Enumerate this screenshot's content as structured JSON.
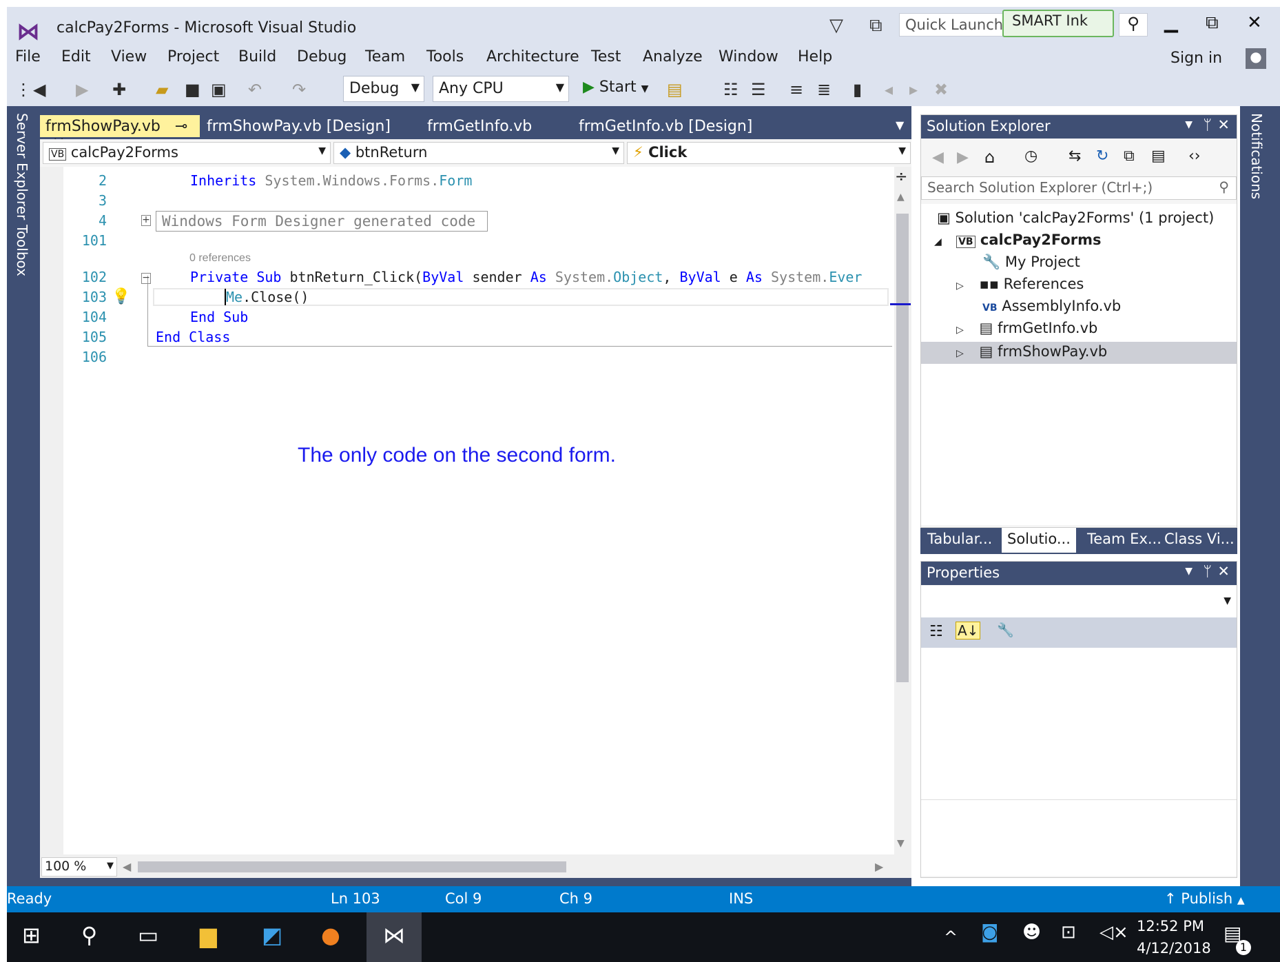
{
  "window": {
    "title": "calcPay2Forms - Microsoft Visual Studio",
    "quick_launch_placeholder": "Quick Launch",
    "smart_ink_label": "SMART Ink",
    "sign_in": "Sign in"
  },
  "menu": [
    "File",
    "Edit",
    "View",
    "Project",
    "Build",
    "Debug",
    "Team",
    "Tools",
    "Architecture",
    "Test",
    "Analyze",
    "Window",
    "Help"
  ],
  "toolbar": {
    "configuration": "Debug",
    "platform": "Any CPU",
    "start_label": "Start"
  },
  "side_tabs": {
    "left": [
      "Server Explorer",
      "Toolbox"
    ],
    "right": "Notifications"
  },
  "doc_tabs": [
    {
      "label": "frmShowPay.vb",
      "active": true
    },
    {
      "label": "frmShowPay.vb [Design]",
      "active": false
    },
    {
      "label": "frmGetInfo.vb",
      "active": false
    },
    {
      "label": "frmGetInfo.vb [Design]",
      "active": false
    }
  ],
  "navbar": {
    "project": "calcPay2Forms",
    "object": "btnReturn",
    "event": "Click"
  },
  "code": {
    "line_numbers": [
      "2",
      "3",
      "4",
      "101",
      "102",
      "103",
      "104",
      "105",
      "106"
    ],
    "region_label": "Windows Form Designer generated code",
    "codelens": "0 references",
    "inherits": {
      "kw": "Inherits",
      "ns": "System.Windows.Forms.",
      "ty": "Form"
    },
    "sub_line": {
      "kw1": "Private",
      "kw2": "Sub",
      "name": "btnReturn_Click(",
      "kw3": "ByVal",
      "p1": "sender",
      "kw4": "As",
      "ns1": "System.",
      "ty1": "Object",
      "sep": ", ",
      "kw5": "ByVal",
      "p2": "e",
      "kw6": "As",
      "ns2": "System.",
      "ty2": "Ever"
    },
    "close_line": {
      "kw": "Me",
      "rest": ".Close()"
    },
    "end_sub": "End Sub",
    "end_class_kw": "End",
    "end_class_name": "Class"
  },
  "annotation": "The only code on the second form.",
  "editor_zoom": "100 %",
  "solution_explorer": {
    "title": "Solution Explorer",
    "search_placeholder": "Search Solution Explorer (Ctrl+;)",
    "tree": [
      {
        "label": "Solution 'calcPay2Forms' (1 project)",
        "icon": "solution-icon"
      },
      {
        "label": "calcPay2Forms",
        "icon": "vb-project-icon",
        "bold": true
      },
      {
        "label": "My Project",
        "icon": "wrench-icon"
      },
      {
        "label": "References",
        "icon": "references-icon"
      },
      {
        "label": "AssemblyInfo.vb",
        "icon": "vb-file-icon"
      },
      {
        "label": "frmGetInfo.vb",
        "icon": "form-icon"
      },
      {
        "label": "frmShowPay.vb",
        "icon": "form-icon",
        "selected": true
      }
    ]
  },
  "panel_tabs": [
    "Tabular...",
    "Solutio...",
    "Team Ex...",
    "Class Vi..."
  ],
  "properties": {
    "title": "Properties"
  },
  "status": {
    "state": "Ready",
    "ln": "Ln 103",
    "col": "Col 9",
    "ch": "Ch 9",
    "mode": "INS",
    "publish": "Publish"
  },
  "taskbar": {
    "time": "12:52 PM",
    "date": "4/12/2018",
    "notification_count": "1"
  },
  "colors": {
    "accent": "#007acc",
    "chrome": "#3f4f74",
    "active_tab": "#fff29d",
    "keyword": "#0000ff",
    "type": "#2b91af"
  }
}
